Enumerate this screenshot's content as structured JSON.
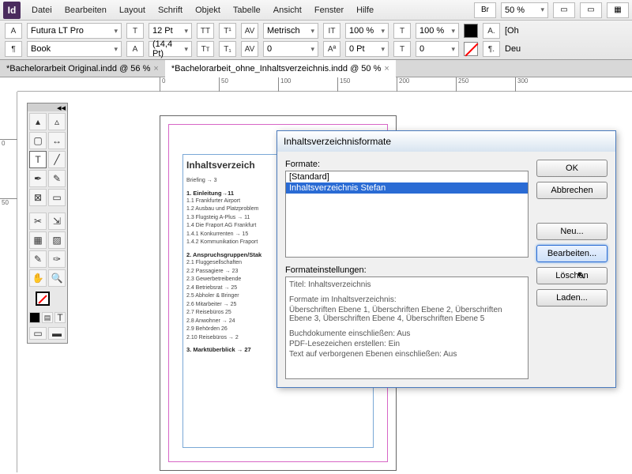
{
  "app": {
    "logo": "Id"
  },
  "menu": [
    "Datei",
    "Bearbeiten",
    "Layout",
    "Schrift",
    "Objekt",
    "Tabelle",
    "Ansicht",
    "Fenster",
    "Hilfe"
  ],
  "top_toolbar": {
    "zoom": "50 %"
  },
  "control_bar": {
    "row1": {
      "font": "Futura LT Pro",
      "size": "12 Pt",
      "tracking_mode": "Metrisch",
      "hscale": "100 %",
      "vscale": "100 %",
      "lang_frag": "[Oh"
    },
    "row2": {
      "style": "Book",
      "leading": "(14,4 Pt)",
      "kerning": "0",
      "baseline": "0 Pt",
      "skew": "0",
      "lang": "Deu"
    }
  },
  "tabs": [
    {
      "label": "*Bachelorarbeit Original.indd @ 56 %",
      "active": false
    },
    {
      "label": "*Bachelorarbeit_ohne_Inhaltsverzeichnis.indd @ 50 %",
      "active": true
    }
  ],
  "ruler_h": [
    "0",
    "50",
    "100",
    "150",
    "200",
    "250",
    "300"
  ],
  "ruler_v": [
    "0",
    "50"
  ],
  "page": {
    "title": "Inhaltsverzeich",
    "briefing": "Briefing → 3",
    "sections": [
      {
        "head": "1. Einleitung→11",
        "items": [
          "1.1 Frankfurter Airport",
          "1.2 Ausbau und Platzproblem",
          "1.3 Flugsteig A-Plus → 11",
          "1.4 Die Fraport AG Frankfurt",
          "1.4.1 Konkurrenten → 15",
          "1.4.2 Kommunikation Fraport"
        ]
      },
      {
        "head": "2. Anspruchsgruppen/Stak",
        "items": [
          "2.1 Fluggesellschaften",
          "2.2 Passagiere → 23",
          "2.3 Gewerbetreibende",
          "2.4 Betriebsrat → 25",
          "2.5 Abholer & Bringer",
          "2.6 Mitarbeiter → 25",
          "2.7 Reisebüros 25",
          "2.8 Anwohner → 24",
          "2.9 Behörden 26",
          "2.10 Reisebüros → 2"
        ]
      },
      {
        "head": "3. Marktüberblick → 27",
        "items": []
      }
    ]
  },
  "dialog": {
    "title": "Inhaltsverzeichnisformate",
    "formats_label": "Formate:",
    "formats": [
      "[Standard]",
      "Inhaltsverzeichnis Stefan"
    ],
    "selected": 1,
    "settings_label": "Formateinstellungen:",
    "settings": {
      "l1": "Titel: Inhaltsverzeichnis",
      "l2": "Formate im Inhaltsverzeichnis:",
      "l3": "Überschriften Ebene 1, Überschriften Ebene 2, Überschriften Ebene 3, Überschriften Ebene 4, Überschriften Ebene 5",
      "l4": "Buchdokumente einschließen: Aus",
      "l5": "PDF-Lesezeichen erstellen: Ein",
      "l6": "Text auf verborgenen Ebenen einschließen: Aus"
    },
    "buttons": {
      "ok": "OK",
      "cancel": "Abbrechen",
      "new": "Neu...",
      "edit": "Bearbeiten...",
      "delete": "Löschen",
      "load": "Laden..."
    }
  }
}
